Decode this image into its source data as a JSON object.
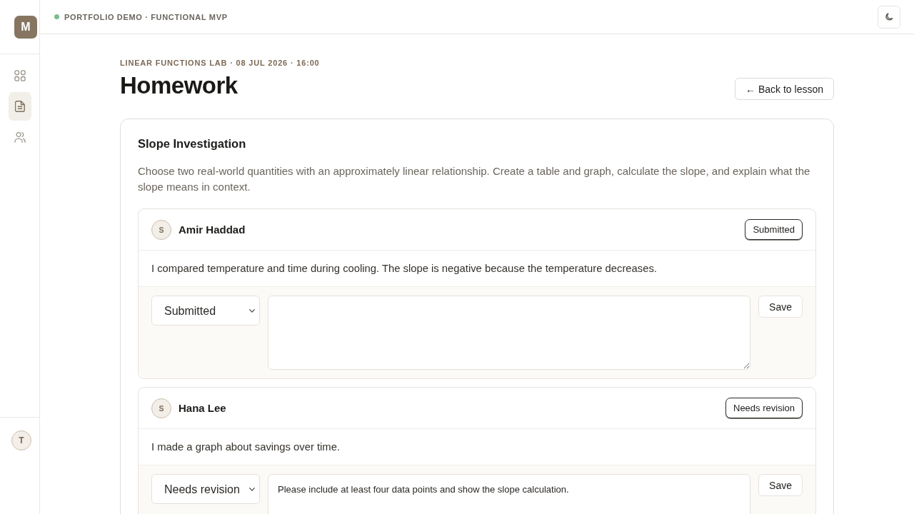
{
  "sidebar": {
    "logo": "M",
    "nav_items": [
      {
        "kind": "grid",
        "selected": false
      },
      {
        "kind": "document",
        "selected": true
      },
      {
        "kind": "people",
        "selected": false
      }
    ],
    "user_avatar": "T"
  },
  "top_bar": {
    "status_label": "PORTFOLIO DEMO · FUNCTIONAL MVP"
  },
  "page": {
    "eyebrow": "LINEAR FUNCTIONS LAB · 08 JUL 2026 · 16:00",
    "title": "Homework",
    "back_button": "← Back to lesson"
  },
  "assignment": {
    "title": "Slope Investigation",
    "description": "Choose two real-world quantities with an approximately linear relationship. Create a table and graph, calculate the slope, and explain what the slope means in context."
  },
  "submissions": [
    {
      "avatar": "S",
      "student": "Amir Haddad",
      "status_badge": "Submitted",
      "response": "I compared temperature and time during cooling. The slope is negative because the temperature decreases.",
      "status_select": "Submitted",
      "save_button": "Save"
    },
    {
      "avatar": "S",
      "student": "Hana Lee",
      "status_badge": "Needs revision",
      "response": "I made a graph about savings over time.",
      "status_select": "Needs revision",
      "feedback": "Please include at least four data points and show the slope calculation.",
      "save_button": "Save"
    }
  ]
}
